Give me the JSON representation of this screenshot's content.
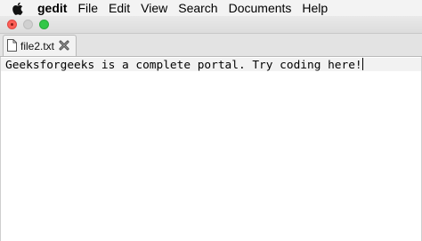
{
  "menubar": {
    "apple_icon": "apple-logo",
    "items": [
      "gedit",
      "File",
      "Edit",
      "View",
      "Search",
      "Documents",
      "Help"
    ]
  },
  "window": {
    "traffic_lights": {
      "close": "#fc5f57",
      "minimize": "#d0d0d0",
      "maximize": "#33c748"
    }
  },
  "tabs": [
    {
      "label": "file2.txt",
      "icon": "document-icon",
      "close_icon": "close-icon"
    }
  ],
  "editor": {
    "lines": [
      "Geeksforgeeks is a complete portal. Try coding here!"
    ]
  }
}
